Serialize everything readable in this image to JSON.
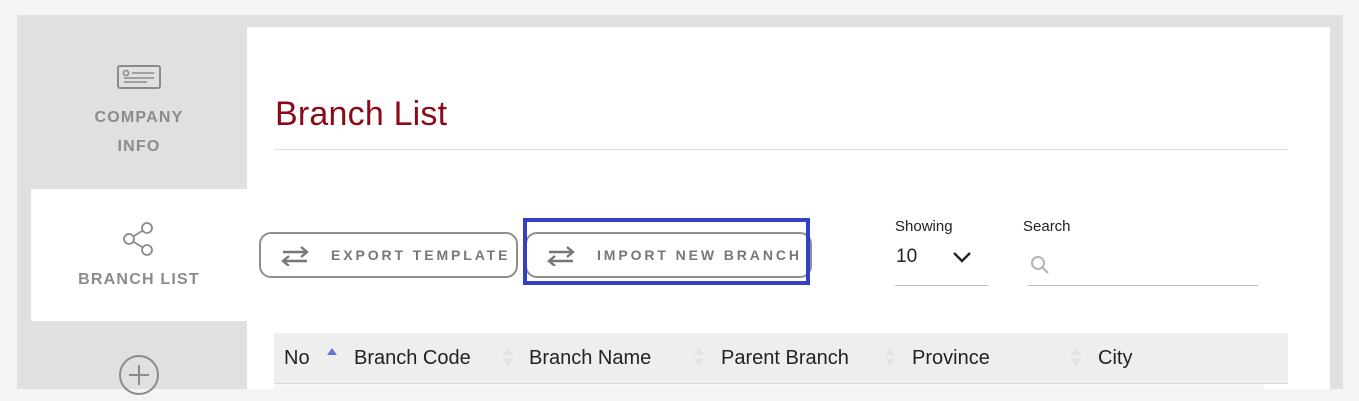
{
  "sidebar": {
    "items": [
      {
        "label_line1": "COMPANY",
        "label_line2": "INFO",
        "icon": "id-card-icon"
      },
      {
        "label": "BRANCH LIST",
        "icon": "share-icon",
        "active": true
      },
      {
        "icon": "plus-circle-icon"
      }
    ]
  },
  "page": {
    "title": "Branch List"
  },
  "toolbar": {
    "export_label": "EXPORT TEMPLATE",
    "import_label": "IMPORT NEW BRANCH",
    "icon": "swap-arrows-icon"
  },
  "showing": {
    "label": "Showing",
    "value": "10"
  },
  "search": {
    "label": "Search",
    "placeholder": "",
    "value": ""
  },
  "table": {
    "columns": [
      "No",
      "Branch Code",
      "Branch Name",
      "Parent Branch",
      "Province",
      "City"
    ],
    "sorted_column": "No",
    "sort_direction": "ascending"
  },
  "colors": {
    "title": "#8b0a17",
    "highlight": "#3340c4",
    "sort_active": "#6c73d6",
    "sidebar_bg": "#dfe1e0"
  }
}
